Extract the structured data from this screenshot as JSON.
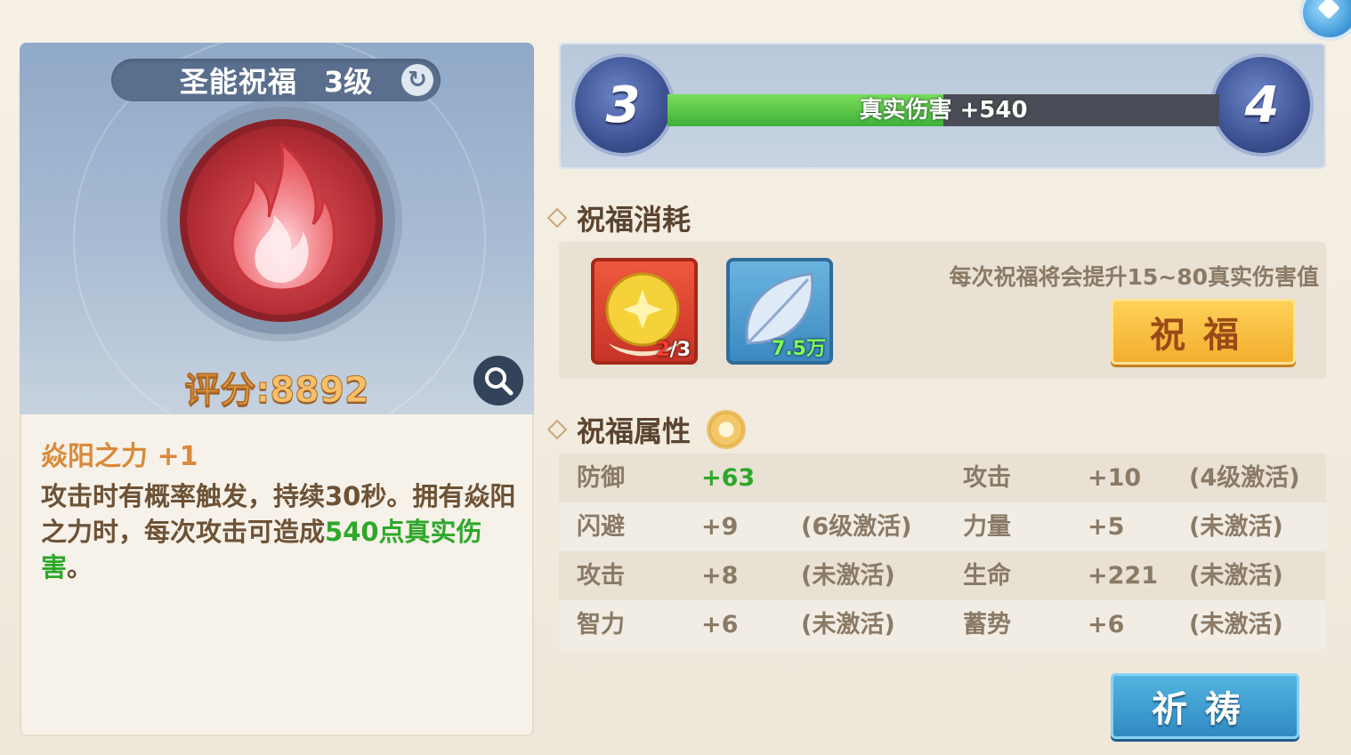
{
  "blessing": {
    "name": "圣能祝福",
    "level": "3级",
    "score": "评分:8892"
  },
  "skill": {
    "name": "焱阳之力 +1",
    "desc_prefix": "攻击时有概率触发，持续30秒。拥有焱阳之力时，每次攻击可造成",
    "desc_highlight": "540点真实伤害",
    "desc_suffix": "。"
  },
  "progress": {
    "current_level": "3",
    "next_level": "4",
    "bonus_text": "真实伤害 +540",
    "fill_fraction": 0.5
  },
  "cost_section": {
    "title": "祝福消耗",
    "items": [
      {
        "owned": "2",
        "separator": "/",
        "required": "3"
      },
      {
        "count": "7.5万"
      }
    ],
    "note": "每次祝福将会提升15~80真实伤害值",
    "bless_button": "祝福"
  },
  "attr_section": {
    "title": "祝福属性",
    "rows": [
      {
        "a_name": "防御",
        "a_val": "+63",
        "a_status": "",
        "b_name": "攻击",
        "b_val": "+10",
        "b_status": "(4级激活)"
      },
      {
        "a_name": "闪避",
        "a_val": "+9",
        "a_status": "(6级激活)",
        "b_name": "力量",
        "b_val": "+5",
        "b_status": "(未激活)"
      },
      {
        "a_name": "攻击",
        "a_val": "+8",
        "a_status": "(未激活)",
        "b_name": "生命",
        "b_val": "+221",
        "b_status": "(未激活)"
      },
      {
        "a_name": "智力",
        "a_val": "+6",
        "a_status": "(未激活)",
        "b_name": "蓄势",
        "b_val": "+6",
        "b_status": "(未激活)"
      }
    ]
  },
  "pray_button": "祈祷",
  "icons": {
    "refresh": "refresh-icon",
    "zoom": "magnifier-icon",
    "flame": "flame-icon",
    "gem": "gem-icon"
  },
  "colors": {
    "score": "#f4c06a",
    "highlight": "#2da82a",
    "bless_button": "#f2ad2d",
    "pray_button": "#2e88c0"
  }
}
